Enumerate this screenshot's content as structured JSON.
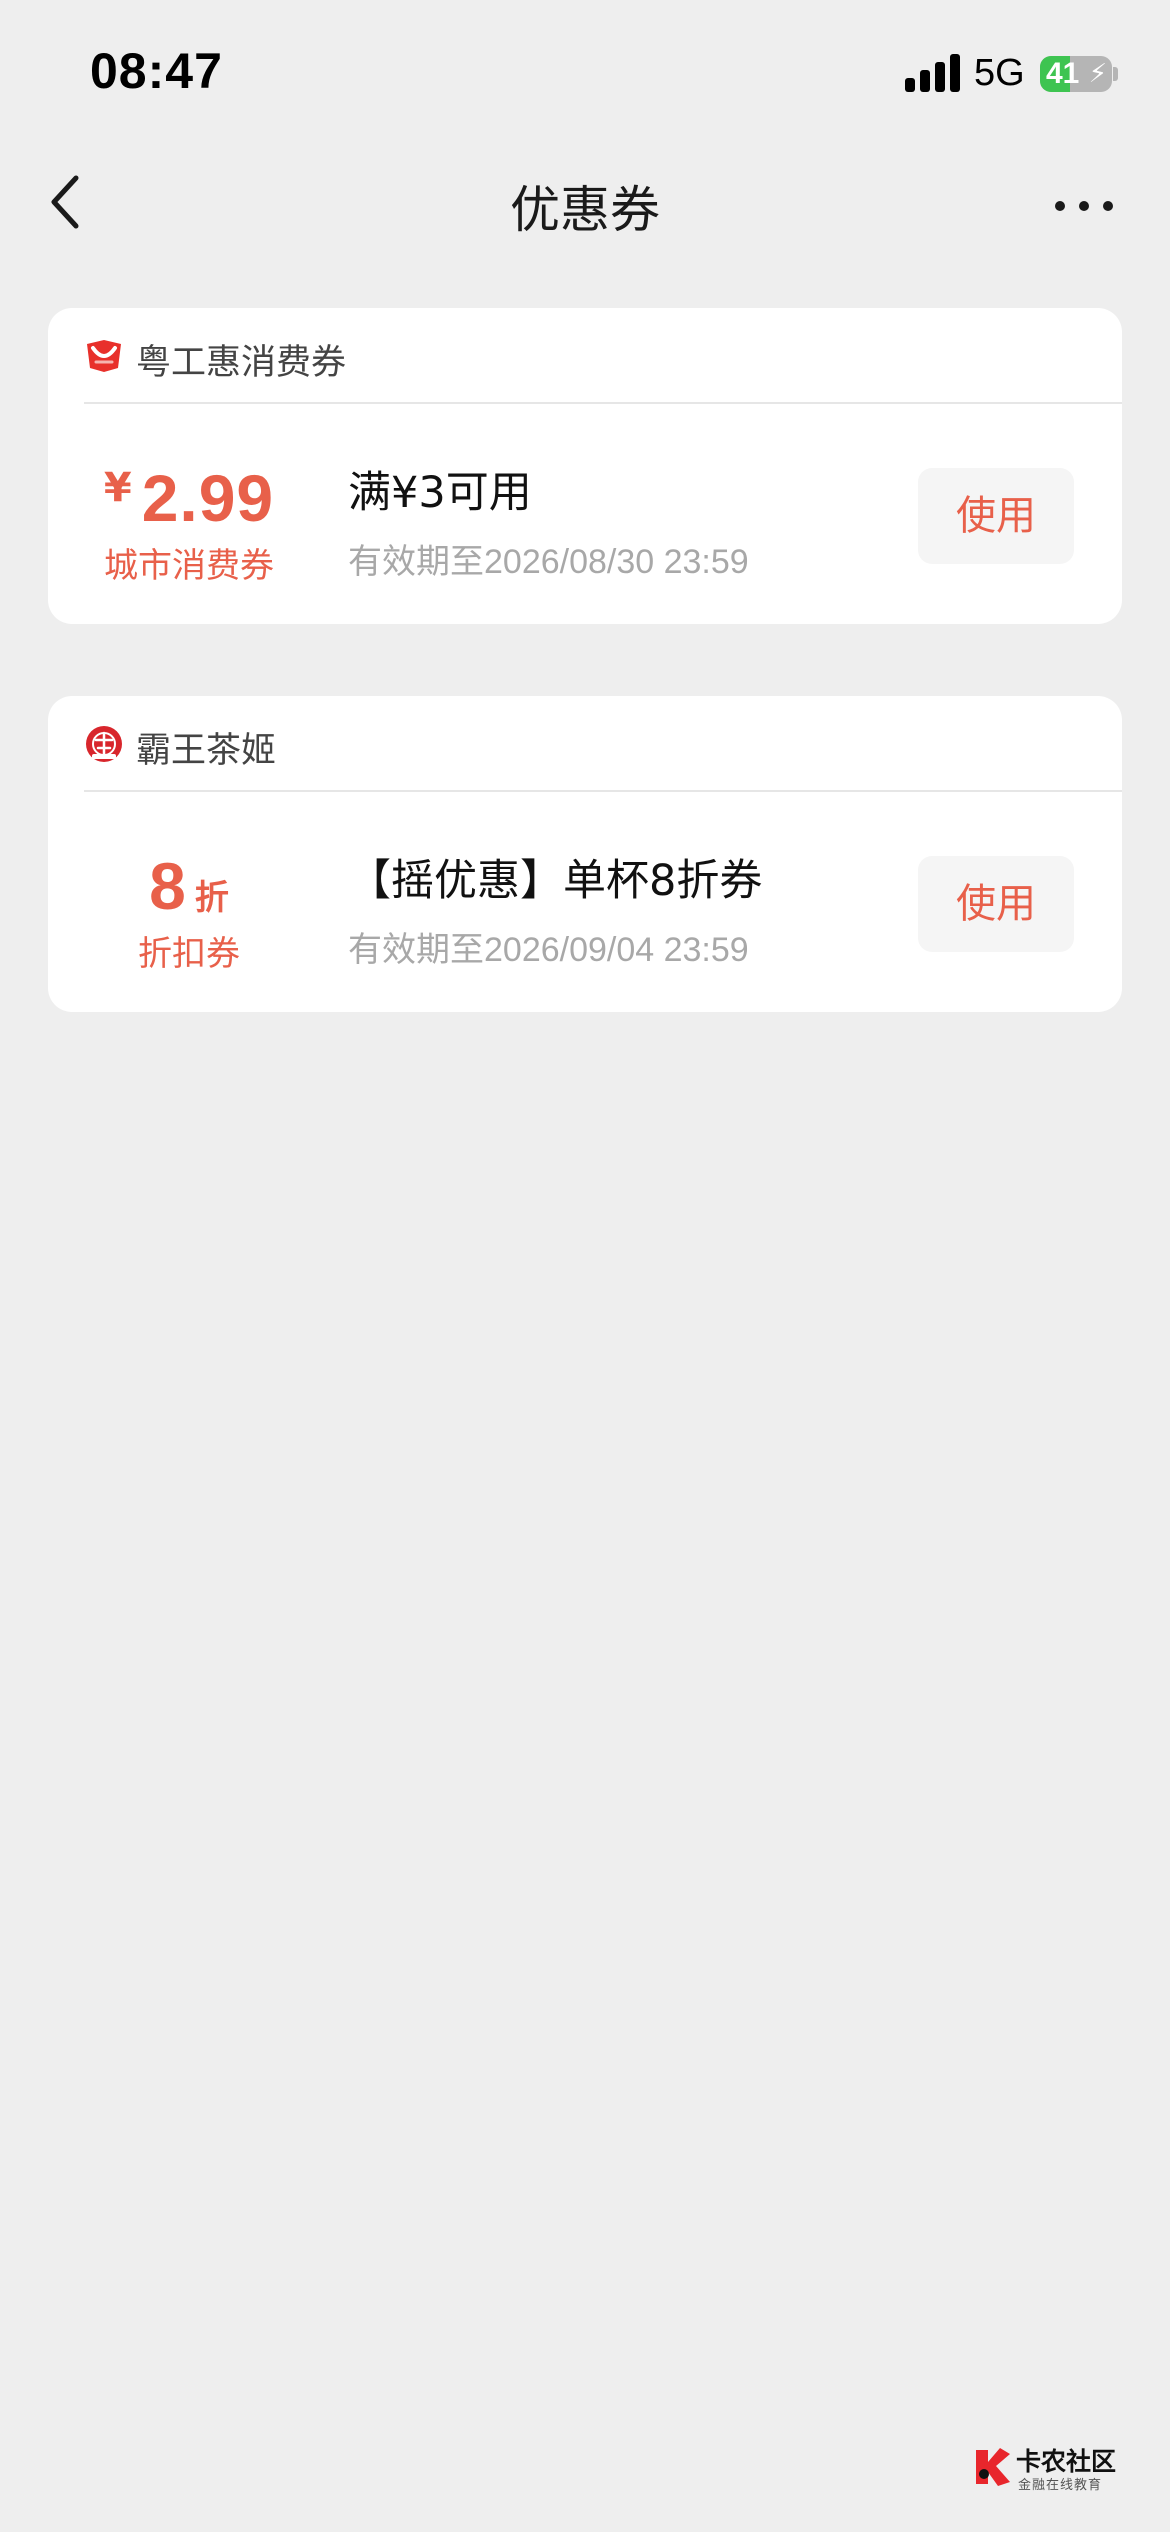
{
  "status_bar": {
    "time": "08:47",
    "network": "5G",
    "battery_level": 41,
    "battery_text": "41",
    "charging_icon": "lightning-bolt-icon"
  },
  "nav": {
    "back_icon": "chevron-left-icon",
    "title": "优惠券",
    "more_icon": "more-dots-icon"
  },
  "coupons": [
    {
      "brand_logo_icon": "red-ribbon-logo",
      "brand": "粤工惠消费券",
      "currency_symbol": "¥",
      "amount": "2.99",
      "type_label": "城市消费券",
      "title": "满¥3可用",
      "expiry": "有效期至2026/08/30 23:59",
      "action_label": "使用"
    },
    {
      "brand_logo_icon": "bawang-chaji-logo",
      "brand": "霸王茶姬",
      "amount": "8",
      "unit": "折",
      "type_label": "折扣券",
      "title": "【摇优惠】单杯8折券",
      "expiry": "有效期至2026/09/04 23:59",
      "action_label": "使用"
    }
  ],
  "colors": {
    "accent": "#e8604a",
    "background": "#eeeeee",
    "card": "#ffffff",
    "battery_green": "#3ec451"
  },
  "watermark": {
    "logo_icon": "kanong-logo",
    "title": "卡农社区",
    "subtitle": "金融在线教育"
  }
}
